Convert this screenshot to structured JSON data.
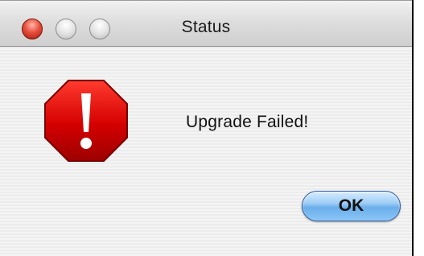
{
  "window": {
    "title": "Status"
  },
  "dialog": {
    "icon": "stop-icon",
    "icon_color": "#d40000",
    "message": "Upgrade Failed!",
    "ok_label": "OK"
  },
  "titlebar": {
    "close_color": "#e8503e",
    "minimize_color": "#e4e4e4",
    "zoom_color": "#e4e4e4"
  }
}
